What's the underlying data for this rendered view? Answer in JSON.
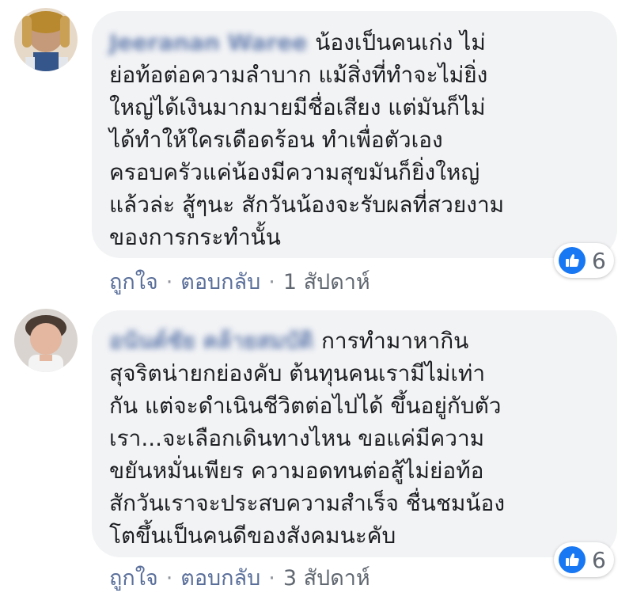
{
  "comments": [
    {
      "author": "Jeeranan Waree",
      "lines": [
        "น้องเป็นคนเก่ง ไม่",
        "ย่อท้อต่อความลำบาก แม้สิ่งที่ทำจะไม่ยิ่ง",
        "ใหญ่ได้เงินมากมายมีชื่อเสียง แต่มันก็ไม่",
        "ได้ทำให้ใครเดือดร้อน ทำเพื่อตัวเอง",
        "ครอบครัวแค่น้องมีความสุขมันก็ยิ่งใหญ่",
        "แล้วล่ะ สู้ๆนะ สักวันน้องจะรับผลที่สวยงาม",
        "ของการกระทำนั้น"
      ],
      "like_label": "ถูกใจ",
      "reply_label": "ตอบกลับ",
      "separator": "·",
      "time": "1 สัปดาห์",
      "reaction_count": "6"
    },
    {
      "author": "อนันต์ชัย คล้ายสมบัติ",
      "lines": [
        "การทำมาหากิน",
        "สุจริตน่ายกย่องคับ ต้นทุนคนเรามีไม่เท่า",
        "กัน แต่จะดำเนินชีวิตต่อไปได้ ขึ้นอยู่กับตัว",
        "เรา...จะเลือกเดินทางไหน ขอแค่มีความ",
        "ขยันหมั่นเพียร ความอดทนต่อสู้ไม่ย่อท้อ",
        "สักวันเราจะประสบความสำเร็จ ชื่นชมน้อง",
        "โตขึ้นเป็นคนดีของสังคมนะคับ"
      ],
      "like_label": "ถูกใจ",
      "reply_label": "ตอบกลับ",
      "separator": "·",
      "time": "3 สัปดาห์",
      "reaction_count": "6"
    }
  ],
  "colors": {
    "bubble": "#f2f3f5",
    "author": "#385898",
    "action_link": "#5a6f9a",
    "like_blue": "#1877f2"
  },
  "icons": {
    "reaction": "thumbs-up-icon",
    "avatar": "user-avatar"
  }
}
